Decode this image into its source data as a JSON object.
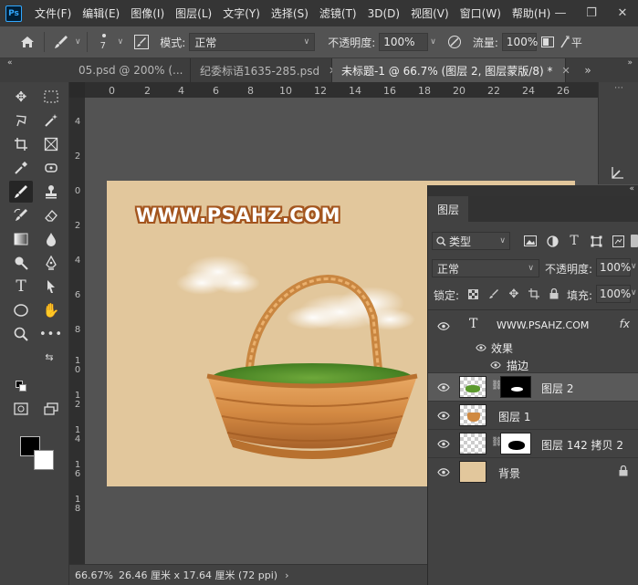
{
  "app": {
    "logo": "Ps"
  },
  "menu": [
    "文件(F)",
    "编辑(E)",
    "图像(I)",
    "图层(L)",
    "文字(Y)",
    "选择(S)",
    "滤镜(T)",
    "3D(D)",
    "视图(V)",
    "窗口(W)",
    "帮助(H)"
  ],
  "options": {
    "brush_size": "7",
    "mode_label": "模式:",
    "mode_value": "正常",
    "opacity_label": "不透明度:",
    "opacity_value": "100%",
    "flow_label": "流量:",
    "flow_value": "100%",
    "smoothing_label": "平"
  },
  "tabs": [
    {
      "label": "05.psd @ 200% (...",
      "active": false
    },
    {
      "label": "纪委标语1635-285.psd",
      "active": false
    },
    {
      "label": "未标题-1 @ 66.7% (图层 2, 图层蒙版/8) *",
      "active": true
    }
  ],
  "ruler_top": [
    "0",
    "2",
    "4",
    "6",
    "8",
    "10",
    "12",
    "14",
    "16",
    "18",
    "20",
    "22",
    "24",
    "26"
  ],
  "ruler_left": [
    "4",
    "2",
    "0",
    "2",
    "4",
    "6",
    "8",
    "1\n0",
    "1\n2",
    "1\n4",
    "1\n6",
    "1\n8"
  ],
  "canvas": {
    "watermark": "WWW.PSAHZ.COM",
    "background": "#e2c79c"
  },
  "layers_panel": {
    "tab": "图层",
    "filter": "类型",
    "blend": "正常",
    "opacity_label": "不透明度:",
    "opacity_value": "100%",
    "lock_label": "锁定:",
    "fill_label": "填充:",
    "fill_value": "100%",
    "layers": [
      {
        "name": "WWW.PSAHZ.COM",
        "kind": "text",
        "fx": "fx"
      },
      {
        "name": "图层 2",
        "kind": "masked",
        "selected": true
      },
      {
        "name": "图层 1",
        "kind": "pixel"
      },
      {
        "name": "图层 142 拷贝 2",
        "kind": "masked"
      },
      {
        "name": "背景",
        "kind": "background"
      }
    ],
    "effects_label": "效果",
    "stroke_label": "描边"
  },
  "status": {
    "zoom": "66.67%",
    "doc_size": "26.46 厘米 x 17.64 厘米 (72 ppi)"
  },
  "colors": {
    "accent": "#31a8ff",
    "foreground": "#000000",
    "background_swatch": "#ffffff"
  }
}
